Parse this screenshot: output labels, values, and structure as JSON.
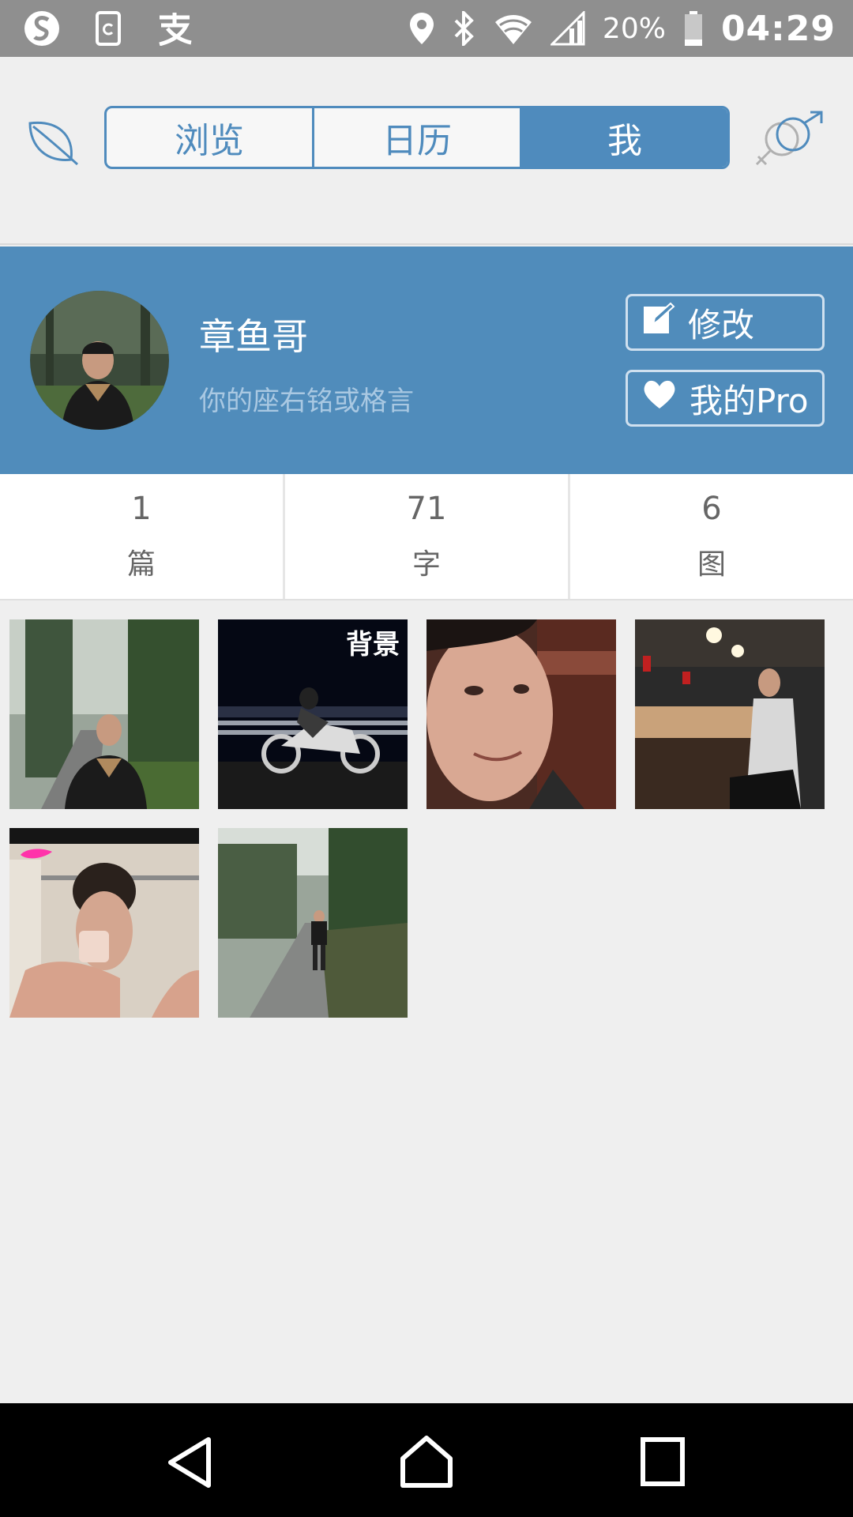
{
  "status_bar": {
    "left_icons": [
      "sogou-icon",
      "sim-sync-icon",
      "alipay-icon"
    ],
    "right_icons": [
      "location-icon",
      "bluetooth-icon",
      "wifi-icon",
      "signal-icon"
    ],
    "battery_percent": "20%",
    "battery_level": 0.2,
    "clock": "04:29"
  },
  "header": {
    "left_icon": "leaf-icon",
    "right_icon": "gender-icon",
    "tabs": [
      {
        "label": "浏览",
        "active": false
      },
      {
        "label": "日历",
        "active": false
      },
      {
        "label": "我",
        "active": true
      }
    ]
  },
  "profile": {
    "name": "章鱼哥",
    "motto": "你的座右铭或格言",
    "edit_label": "修改",
    "pro_label": "我的Pro"
  },
  "stats": [
    {
      "value": "1",
      "label": "篇"
    },
    {
      "value": "71",
      "label": "字"
    },
    {
      "value": "6",
      "label": "图"
    }
  ],
  "photos": {
    "background_badge": "背景",
    "items": [
      "portrait-in-forest",
      "motorcycle-at-night",
      "selfie-closeup",
      "seated-in-restaurant",
      "mirror-selfie",
      "walking-on-road"
    ]
  },
  "nav": {
    "icons": [
      "back-icon",
      "home-icon",
      "recents-icon"
    ]
  },
  "colors": {
    "accent": "#4f8bbd",
    "banner": "#508cbb",
    "status_bar": "#8f8f8f",
    "background": "#efefef"
  }
}
